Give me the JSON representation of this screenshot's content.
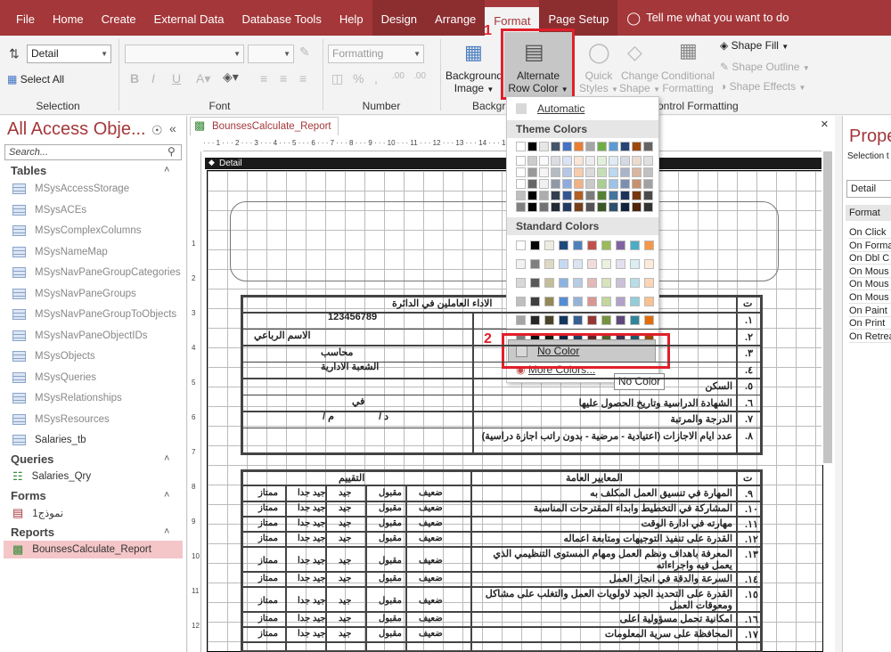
{
  "tabs": [
    "File",
    "Home",
    "Create",
    "External Data",
    "Database Tools",
    "Help",
    "Design",
    "Arrange",
    "Format",
    "Page Setup"
  ],
  "tell_me": "Tell me what you want to do",
  "ribbon": {
    "selection": {
      "combo": "Detail",
      "select_all": "Select All",
      "label": "Selection"
    },
    "font": {
      "label": "Font"
    },
    "number": {
      "combo": "Formatting",
      "label": "Number"
    },
    "background": {
      "bg_image": "Background Image",
      "alt_row": "Alternate Row Color",
      "label": "Backgr"
    },
    "quick_styles": "Quick Styles",
    "change_shape": "Change Shape",
    "conditional": "Conditional Formatting",
    "control_label": "ontrol Formatting",
    "shape_fill": "Shape Fill",
    "shape_outline": "Shape Outline",
    "shape_effects": "Shape Effects"
  },
  "callouts": {
    "one": "1",
    "two": "2"
  },
  "colormenu": {
    "automatic": "Automatic",
    "theme": "Theme Colors",
    "standard": "Standard Colors",
    "no_color": "No Color",
    "more": "More Colors...",
    "tooltip": "No Color"
  },
  "theme_top": [
    "#ffffff",
    "#000000",
    "#e7e6e6",
    "#44546a",
    "#4472c4",
    "#ed7d31",
    "#a5a5a5",
    "#70ad47",
    "#5b9bd5",
    "#264478",
    "#9e480e",
    "#636363"
  ],
  "theme_cols": [
    "#ffffff",
    "#000000",
    "#e7e6e6",
    "#44546a",
    "#4472c4",
    "#ed7d31",
    "#a5a5a5",
    "#70ad47",
    "#5b9bd5",
    "#264478",
    "#9e480e",
    "#636363"
  ],
  "standard_colors": [
    [
      "#ffffff",
      "#000000",
      "#eeece1",
      "#1f497d",
      "#4f81bd",
      "#c0504d",
      "#9bbb59",
      "#8064a2",
      "#4bacc6",
      "#f79646"
    ],
    [
      "#f2f2f2",
      "#7f7f7f",
      "#ddd9c3",
      "#c6d9f0",
      "#dbe5f1",
      "#f2dcdb",
      "#ebf1dd",
      "#e5e0ec",
      "#dbeef3",
      "#fdeada"
    ],
    [
      "#d8d8d8",
      "#595959",
      "#c4bd97",
      "#8db3e2",
      "#b8cce4",
      "#e5b9b7",
      "#d7e3bc",
      "#ccc1d9",
      "#b7dde8",
      "#fbd5b5"
    ],
    [
      "#bfbfbf",
      "#3f3f3f",
      "#938953",
      "#548dd4",
      "#95b3d7",
      "#d99694",
      "#c3d69b",
      "#b2a2c7",
      "#92cddc",
      "#fac08f"
    ],
    [
      "#a5a5a5",
      "#262626",
      "#494429",
      "#17365d",
      "#366092",
      "#953734",
      "#76923c",
      "#5f497a",
      "#31859b",
      "#e36c09"
    ],
    [
      "#7f7f7f",
      "#0c0c0c",
      "#1d1b10",
      "#0f243e",
      "#244061",
      "#632423",
      "#4f6128",
      "#3f3151",
      "#205867",
      "#974806"
    ],
    [
      "#c00000",
      "#ff0000",
      "#ffc000",
      "#ffff00",
      "#92d050",
      "#00b050",
      "#00b0f0",
      "#0070c0",
      "#002060",
      "#7030a0"
    ]
  ],
  "nav": {
    "title": "All Access Obje...",
    "search": "Search...",
    "tables_label": "Tables",
    "tables": [
      "MSysAccessStorage",
      "MSysACEs",
      "MSysComplexColumns",
      "MSysNameMap",
      "MSysNavPaneGroupCategories",
      "MSysNavPaneGroups",
      "MSysNavPaneGroupToObjects",
      "MSysNavPaneObjectIDs",
      "MSysObjects",
      "MSysQueries",
      "MSysRelationships",
      "MSysResources",
      "Salaries_tb"
    ],
    "queries_label": "Queries",
    "query": "Salaries_Qry",
    "forms_label": "Forms",
    "form": "نموذج1",
    "reports_label": "Reports",
    "report": "BounsesCalculate_Report"
  },
  "doc": {
    "tab": "BounsesCalculate_Report",
    "detail": "Detail"
  },
  "report": {
    "title": "الاداء العاملين في الدائرة",
    "number": "123456789",
    "name": "الاسم الرباعي",
    "job": "محاسب",
    "dept": "الشعبة الادارية",
    "rows1": [
      "١.",
      "٢.",
      "٣.",
      "٤.",
      "٥.",
      "٦.",
      "٧.",
      "٨."
    ],
    "labels1": [
      "",
      "",
      "",
      "",
      "السكن",
      "الشهادة الدراسية وتاريخ الحصول عليها",
      "الدرجة والمرتبة",
      "عدد ايام الاجازات (اعتيادية - مرضية - بدون راتب اجازة دراسية)"
    ],
    "fee": "في",
    "dm": "د /",
    "m": "م /",
    "t": "ت",
    "standards": "المعايير العامة",
    "eval": "التقييم",
    "rows2": [
      "٩.",
      "١٠.",
      "١١.",
      "١٢.",
      "١٣.",
      "١٤.",
      "١٥.",
      "١٦.",
      "١٧."
    ],
    "labels2": [
      "المهارة في تنسيق العمل المكلف به",
      "المشاركة في التخطيط وابداء المقترحات المناسبة",
      "مهارته في ادارة الوقت",
      "القدرة على تنفيذ التوجيهات ومتابعة اعماله",
      "المعرفة باهداف ونظم العمل ومهام المستوى التنظيمي الذي يعمل فيه واجراءاته",
      "السرعة والدقة في انجاز العمل",
      "القدرة على التحديد الجيد لاولويات العمل والتغلب على مشاكل ومعوقات العمل",
      "امكانية تحمل مسؤولية اعلى",
      "المحافظة على سرية المعلومات"
    ],
    "grades": [
      "ضعيف",
      "مقبول",
      "جيد",
      "جيد جدا",
      "ممتاز"
    ]
  },
  "close": "×",
  "prop": {
    "title": "Prope",
    "sel": "Selection t",
    "combo": "Detail",
    "tab": "Format",
    "items": [
      "On Click",
      "On Forma",
      "On Dbl C",
      "On Mous",
      "On Mous",
      "On Mous",
      "On Paint",
      "On Print",
      "On Retrea"
    ]
  }
}
